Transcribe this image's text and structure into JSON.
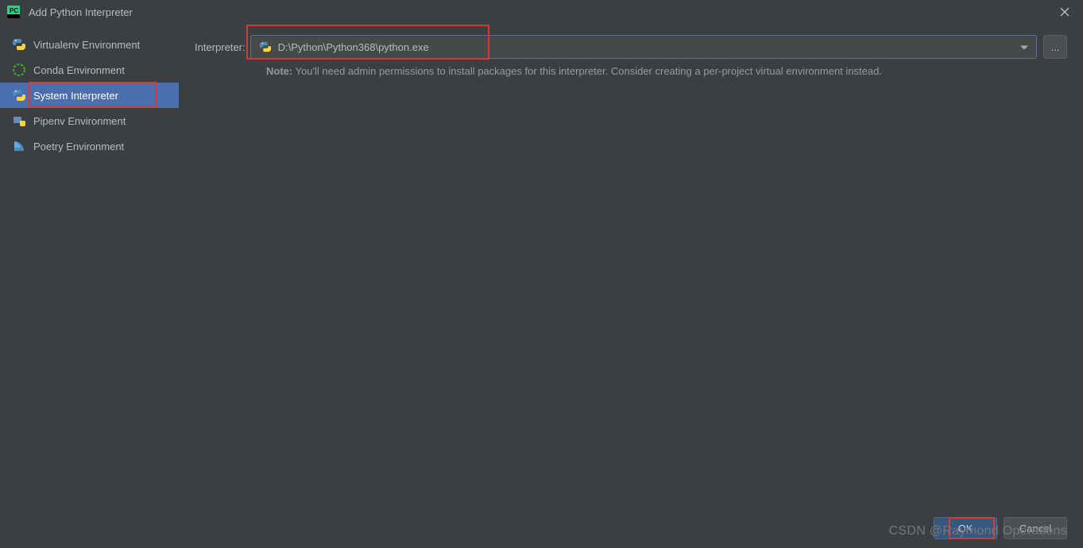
{
  "window": {
    "title": "Add Python Interpreter"
  },
  "sidebar": {
    "items": [
      {
        "label": "Virtualenv Environment",
        "icon": "python-icon"
      },
      {
        "label": "Conda Environment",
        "icon": "conda-icon"
      },
      {
        "label": "System Interpreter",
        "icon": "python-icon",
        "selected": true
      },
      {
        "label": "Pipenv Environment",
        "icon": "pipenv-icon"
      },
      {
        "label": "Poetry Environment",
        "icon": "poetry-icon"
      }
    ]
  },
  "main": {
    "interpreter_label": "Interpreter:",
    "interpreter_value": "D:\\Python\\Python368\\python.exe",
    "note_label": "Note:",
    "note_text": " You'll need admin permissions to install packages for this interpreter. Consider creating a per-project virtual environment instead."
  },
  "footer": {
    "ok_label": "OK",
    "cancel_label": "Cancel"
  },
  "watermark": "CSDN @Raymond Operations",
  "browse_label": "..."
}
